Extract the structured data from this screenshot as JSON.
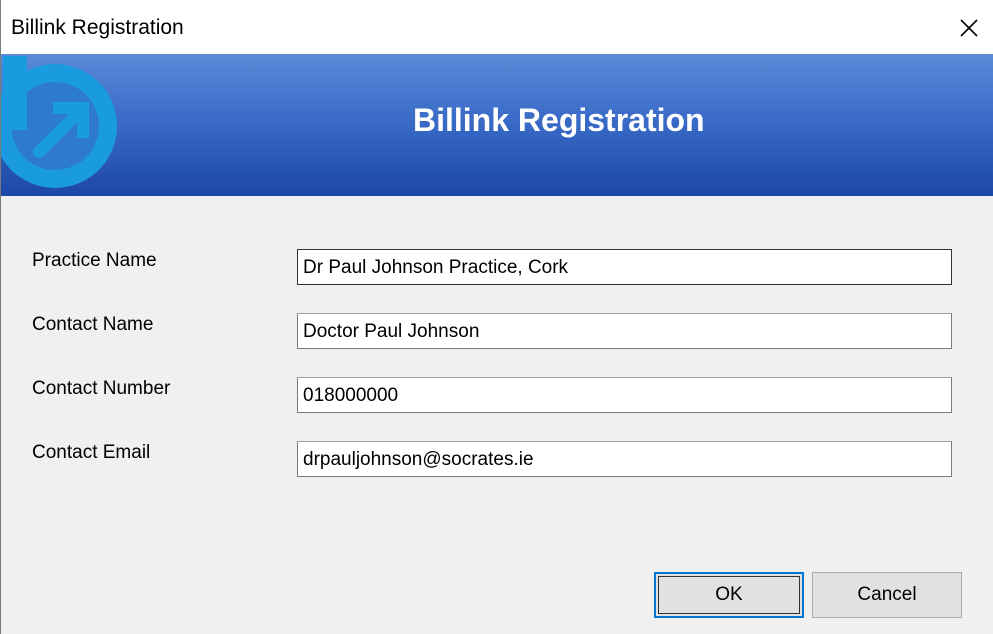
{
  "window": {
    "title": "Billink Registration"
  },
  "banner": {
    "title": "Billink Registration",
    "logo": "billink-logo"
  },
  "form": {
    "practice_name": {
      "label": "Practice Name",
      "value": "Dr Paul Johnson Practice, Cork"
    },
    "contact_name": {
      "label": "Contact Name",
      "value": "Doctor Paul Johnson"
    },
    "contact_number": {
      "label": "Contact Number",
      "value": "018000000"
    },
    "contact_email": {
      "label": "Contact Email",
      "value": "drpauljohnson@socrates.ie"
    }
  },
  "buttons": {
    "ok_label": "OK",
    "cancel_label": "Cancel"
  },
  "icons": {
    "close": "close-icon"
  },
  "colors": {
    "banner_top": "#5b8ad8",
    "banner_bottom": "#1c47a8",
    "logo": "#1a9be0",
    "default_button_border": "#0078d7"
  }
}
